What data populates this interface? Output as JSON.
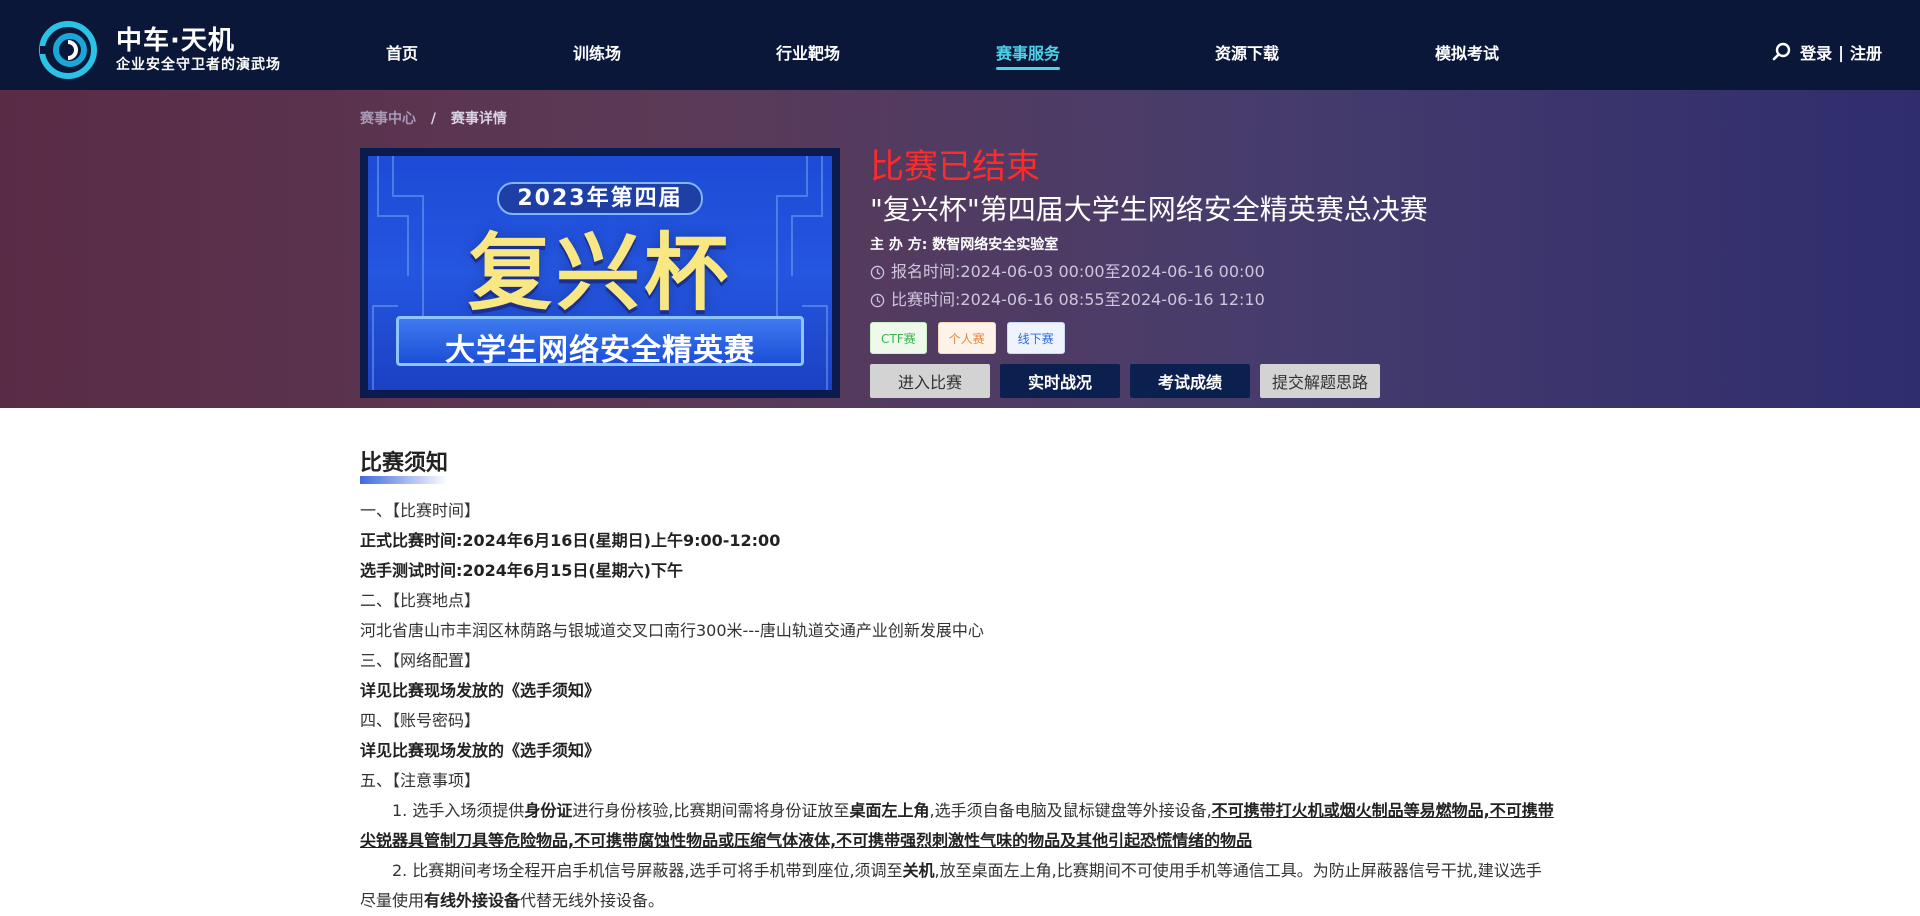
{
  "brand": {
    "title": "中车·天机",
    "subtitle": "企业安全守卫者的演武场"
  },
  "nav": {
    "items": [
      "首页",
      "训练场",
      "行业靶场",
      "赛事服务",
      "资源下载",
      "模拟考试"
    ],
    "active_index": 3,
    "login": "登录",
    "sep": "|",
    "register": "注册"
  },
  "breadcrumb": {
    "parent": "赛事中心",
    "sep": "/",
    "current": "赛事详情"
  },
  "banner": {
    "year": "2023年第四届",
    "main": "复兴杯",
    "sub": "大学生网络安全精英赛"
  },
  "event": {
    "status": "比赛已结束",
    "title": "\"复兴杯\"第四届大学生网络安全精英赛总决赛",
    "host_label": "主 办 方:",
    "host": "数智网络安全实验室",
    "signup_label": "报名时间:",
    "signup_time": "2024-06-03 00:00至2024-06-16 00:00",
    "match_label": "比赛时间:",
    "match_time": "2024-06-16 08:55至2024-06-16 12:10",
    "tags": [
      "CTF赛",
      "个人赛",
      "线下赛"
    ],
    "buttons": [
      "进入比赛",
      "实时战况",
      "考试成绩",
      "提交解题思路"
    ]
  },
  "notice": {
    "title": "比赛须知",
    "s1": "一、【比赛时间】",
    "s1_a": "正式比赛时间:2024年6月16日(星期日)上午9:00-12:00",
    "s1_b": "选手测试时间:2024年6月15日(星期六)下午",
    "s2": "二、【比赛地点】",
    "s2_a": "河北省唐山市丰润区林荫路与银城道交叉口南行300米---唐山轨道交通产业创新发展中心",
    "s3": "三、【网络配置】",
    "s3_a": "详见比赛现场发放的《选手须知》",
    "s4": "四、【账号密码】",
    "s4_a": "详见比赛现场发放的《选手须知》",
    "s5": "五、【注意事项】",
    "p1_a": "1. 选手入场须提供",
    "p1_b": "身份证",
    "p1_c": "进行身份核验,比赛期间需将身份证放至",
    "p1_d": "桌面左上角",
    "p1_e": ",选手须自备电脑及鼠标键盘等外接设备,",
    "p1_f": "不可携带打火机或烟火制品等易燃物品,不可携带尖锐器具管制刀具等危险物品,不可携带腐蚀性物品或压缩气体液体,不可携带强烈刺激性气味的物品及其他引起恐慌情绪的物品",
    "p2_a": "2. 比赛期间考场全程开启手机信号屏蔽器,选手可将手机带到座位,须调至",
    "p2_b": "关机",
    "p2_c": ",放至桌面左上角,比赛期间不可使用手机等通信工具。为防止屏蔽器信号干扰,建议选手尽量使用",
    "p2_d": "有线外接设备",
    "p2_e": "代替无线外接设备。"
  },
  "colors": {
    "nav_bg": "#0a1738",
    "accent": "#4fd1e8",
    "status_red": "#ff2a2a",
    "navy_button": "#0c2050"
  }
}
